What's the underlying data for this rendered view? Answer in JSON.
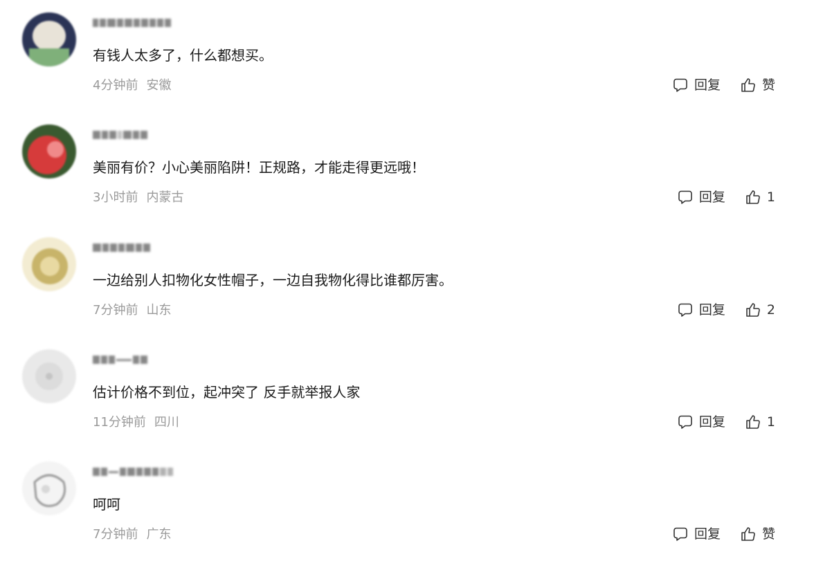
{
  "comments": [
    {
      "content": "有钱人太多了，什么都想买。",
      "time": "4分钟前",
      "location": "安徽",
      "reply_label": "回复",
      "like_label": "赞",
      "avatar_colors": [
        "#2b3456",
        "#e8e3d8",
        "#7fb07a"
      ]
    },
    {
      "content": "美丽有价？小心美丽陷阱！正规路，才能走得更远哦！",
      "time": "3小时前",
      "location": "内蒙古",
      "reply_label": "回复",
      "like_label": "1",
      "avatar_colors": [
        "#3a5a30",
        "#d63b3b",
        "#f08a8a"
      ]
    },
    {
      "content": "一边给别人扣物化女性帽子，一边自我物化得比谁都厉害。",
      "time": "7分钟前",
      "location": "山东",
      "reply_label": "回复",
      "like_label": "2",
      "avatar_colors": [
        "#f3ecd2",
        "#c8b46a",
        "#e8d9a2"
      ]
    },
    {
      "content": "估计价格不到位，起冲突了 反手就举报人家",
      "time": "11分钟前",
      "location": "四川",
      "reply_label": "回复",
      "like_label": "1",
      "avatar_colors": [
        "#e9e9e9",
        "#dcdcdc",
        "#c4c4c4"
      ]
    },
    {
      "content": "呵呵",
      "time": "7分钟前",
      "location": "广东",
      "reply_label": "回复",
      "like_label": "赞",
      "avatar_colors": [
        "#f4f4f4",
        "#9a9a9a",
        "#d8d8d8"
      ]
    }
  ]
}
